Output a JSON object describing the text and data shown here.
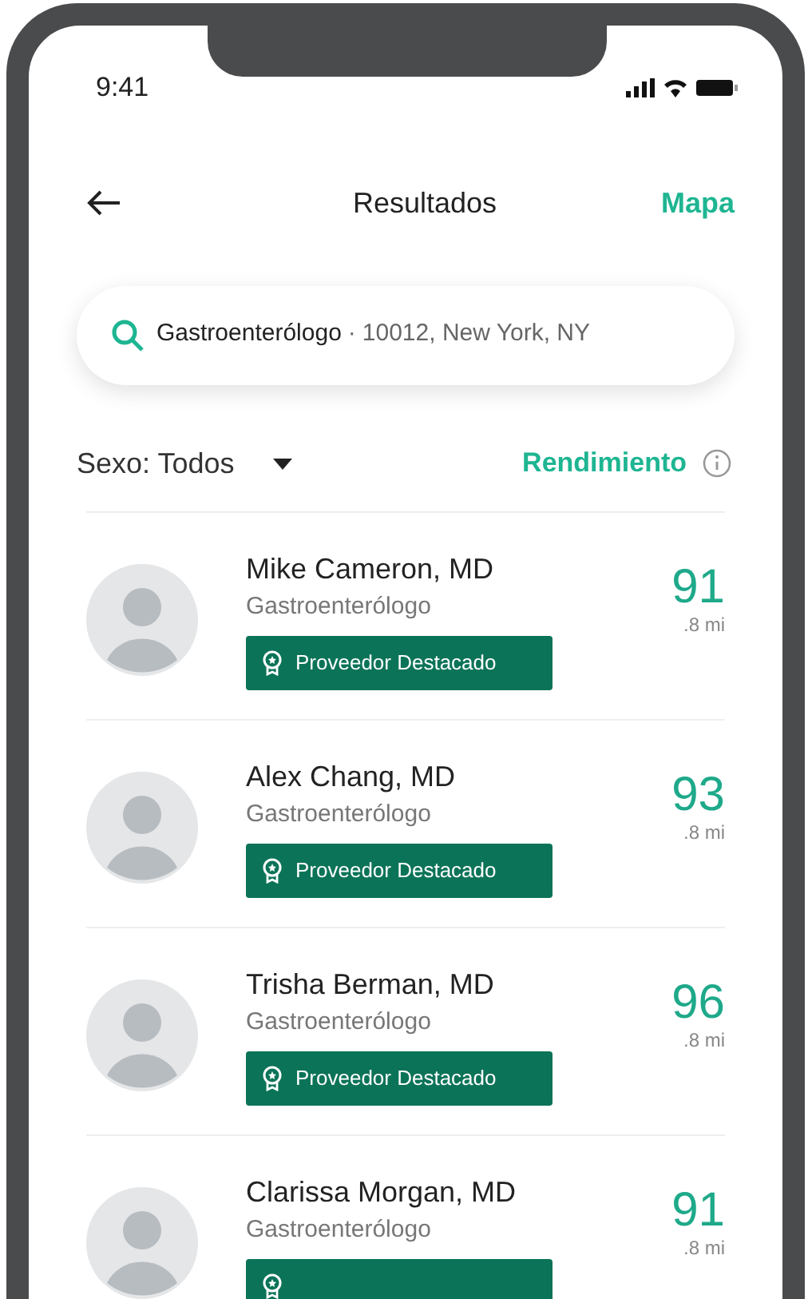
{
  "status_bar": {
    "time": "9:41"
  },
  "header": {
    "title": "Resultados",
    "action": "Mapa"
  },
  "search": {
    "specialty": "Gastroenterólogo",
    "separator": "·",
    "location": "10012, New York, NY"
  },
  "filters": {
    "gender": "Sexo: Todos",
    "sort": "Rendimiento"
  },
  "results": [
    {
      "name": "Mike Cameron, MD",
      "specialty": "Gastroenterólogo",
      "featured": true,
      "badge": "Proveedor Destacado",
      "score": "91",
      "distance": ".8 mi"
    },
    {
      "name": "Alex Chang, MD",
      "specialty": "Gastroenterólogo",
      "featured": true,
      "badge": "Proveedor Destacado",
      "score": "93",
      "distance": ".8 mi"
    },
    {
      "name": "Trisha Berman, MD",
      "specialty": "Gastroenterólogo",
      "featured": true,
      "badge": "Proveedor Destacado",
      "score": "96",
      "distance": ".8 mi"
    },
    {
      "name": "Clarissa Morgan, MD",
      "specialty": "Gastroenterólogo",
      "featured": true,
      "score": "91",
      "distance": ".8 mi"
    }
  ]
}
